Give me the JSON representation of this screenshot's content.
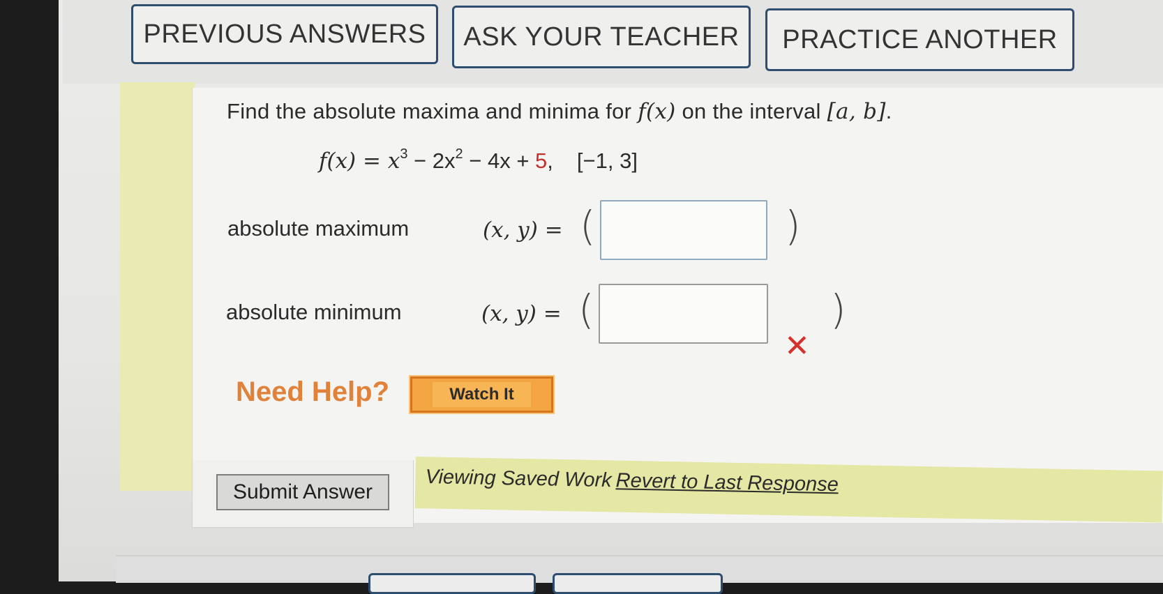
{
  "toolbar": {
    "previous_answers": "PREVIOUS ANSWERS",
    "ask_teacher": "ASK YOUR TEACHER",
    "practice_another": "PRACTICE ANOTHER"
  },
  "question": {
    "prompt_1": "Find the absolute maxima and minima for ",
    "prompt_fx": "f(x)",
    "prompt_2": " on the interval ",
    "prompt_interval": "[a, b]",
    "prompt_end": "."
  },
  "formula": {
    "lhs": "f(x) = x",
    "exp1": "3",
    "mid1": " − 2x",
    "exp2": "2",
    "mid2": " − 4x + ",
    "constant": "5",
    "tail": ",",
    "interval": "[−1, 3]"
  },
  "answers": {
    "max_label": "absolute maximum",
    "max_xy": "(x, y) =",
    "max_value": "",
    "min_label": "absolute minimum",
    "min_xy": "(x, y) =",
    "min_value": "",
    "open_paren": "(",
    "close_paren": ")",
    "wrong_symbol": "✕"
  },
  "help": {
    "label": "Need Help?",
    "watch_button": "Watch It"
  },
  "footer": {
    "submit_button": "Submit Answer",
    "saved_text": "Viewing Saved Work",
    "revert_link": "Revert to Last Response"
  },
  "colors": {
    "accent_border": "#2f4d6e",
    "help_orange": "#e0823a",
    "watch_button": "#f3a542",
    "wrong_red": "#d5322c",
    "highlight_yellow": "#e5e7a4"
  }
}
